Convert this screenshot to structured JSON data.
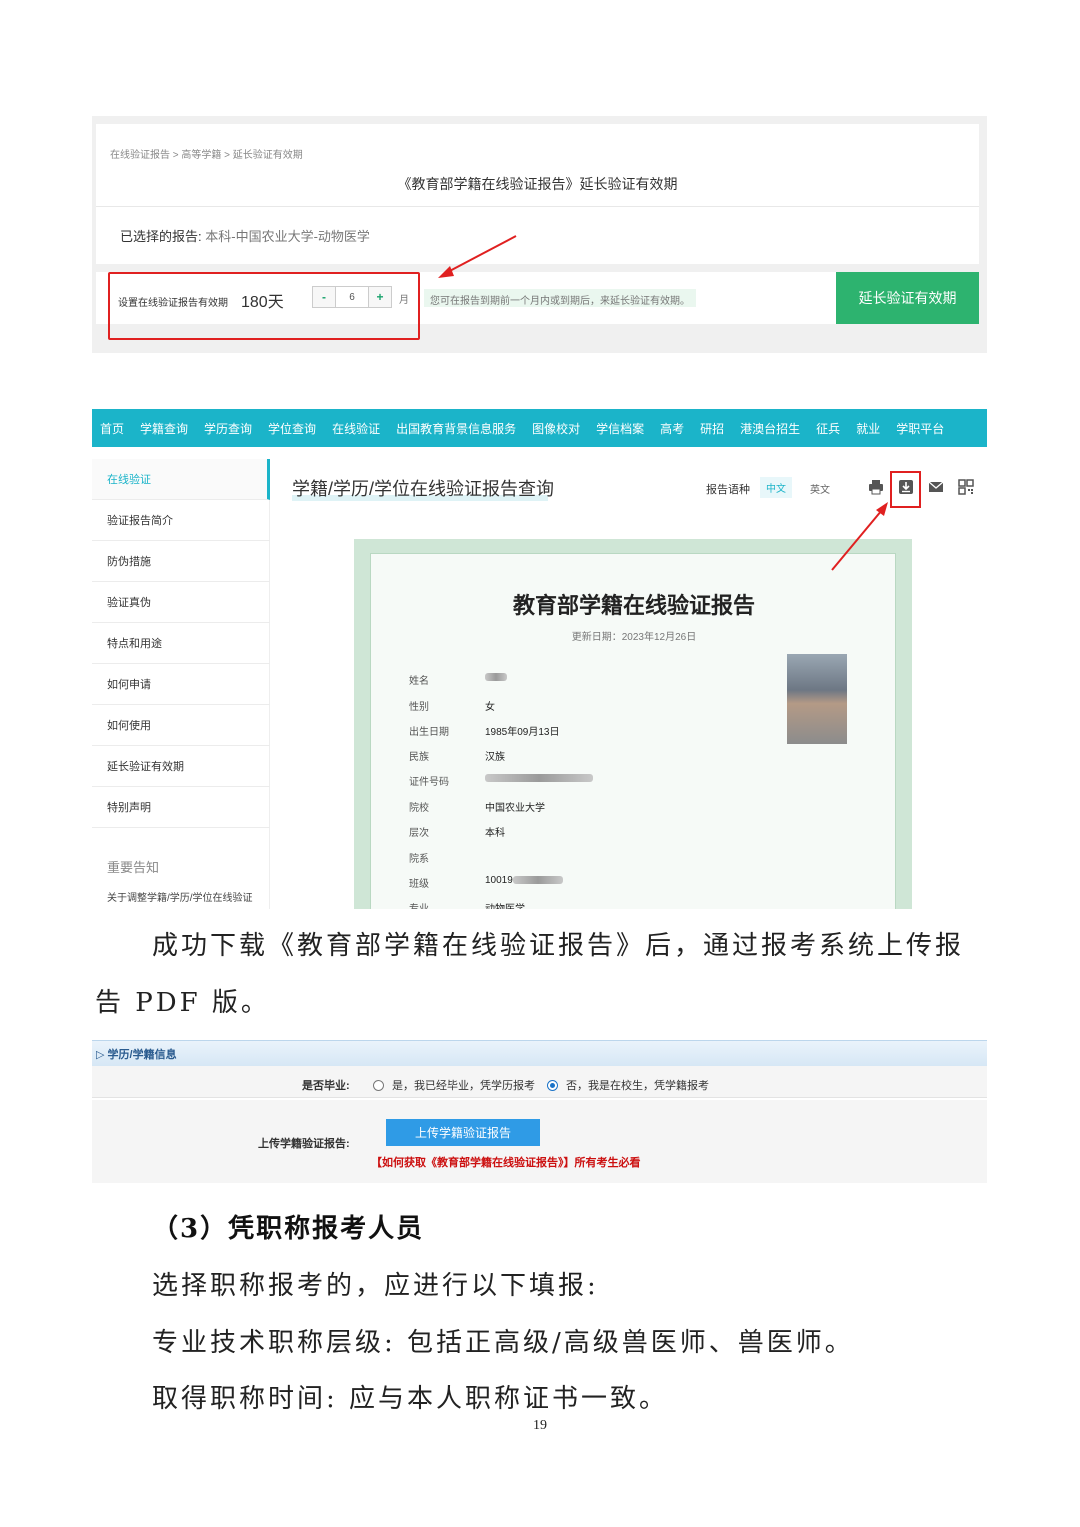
{
  "shot1": {
    "breadcrumb": "在线验证报告 > 高等学籍 > 延长验证有效期",
    "title": "《教育部学籍在线验证报告》延长验证有效期",
    "selected_label": "已选择的报告:",
    "selected_value": "本科-中国农业大学-动物医学",
    "set_label": "设置在线验证报告有效期",
    "days": "180天",
    "minus": "-",
    "stepper_value": "6",
    "plus": "+",
    "unit": "月",
    "hint": "您可在报告到期前一个月内或到期后，来延长验证有效期。",
    "extend_button": "延长验证有效期"
  },
  "shot2": {
    "nav": [
      "首页",
      "学籍查询",
      "学历查询",
      "学位查询",
      "在线验证",
      "出国教育背景信息服务",
      "图像校对",
      "学信档案",
      "高考",
      "研招",
      "港澳台招生",
      "征兵",
      "就业",
      "学职平台"
    ],
    "sidebar": [
      "在线验证",
      "验证报告简介",
      "防伪措施",
      "验证真伪",
      "特点和用途",
      "如何申请",
      "如何使用",
      "延长验证有效期",
      "特别声明"
    ],
    "notice_title": "重要告知",
    "notice_text": "关于调整学籍/学历/学位在线验证",
    "page_title": "学籍/学历/学位在线验证报告查询",
    "lang_label": "报告语种",
    "lang_cn": "中文",
    "lang_en": "英文",
    "icons": [
      "print-icon",
      "download-icon",
      "mail-icon",
      "qrcode-icon"
    ],
    "cert": {
      "title": "教育部学籍在线验证报告",
      "date": "更新日期：2023年12月26日",
      "rows": [
        {
          "k": "姓名",
          "v": ""
        },
        {
          "k": "性别",
          "v": "女"
        },
        {
          "k": "出生日期",
          "v": "1985年09月13日"
        },
        {
          "k": "民族",
          "v": "汉族"
        },
        {
          "k": "证件号码",
          "v": ""
        },
        {
          "k": "院校",
          "v": "中国农业大学"
        },
        {
          "k": "层次",
          "v": "本科"
        },
        {
          "k": "院系",
          "v": ""
        },
        {
          "k": "班级",
          "v": "10019"
        },
        {
          "k": "专业",
          "v": "动物医学"
        }
      ]
    }
  },
  "para1": "成功下载《教育部学籍在线验证报告》后，通过报考系统上传报",
  "para1b": "告 PDF 版。",
  "shot3": {
    "header": "▷ 学历/学籍信息",
    "graduated_label": "是否毕业:",
    "option_yes": "是，我已经毕业，凭学历报考",
    "option_no": "否，我是在校生，凭学籍报考",
    "upload_label": "上传学籍验证报告:",
    "upload_button": "上传学籍验证报告",
    "help_link": "【如何获取《教育部学籍在线验证报告》】所有考生必看"
  },
  "section_title": "（3）凭职称报考人员",
  "para2": "选择职称报考的，应进行以下填报:",
  "para3": "专业技术职称层级: 包括正高级/高级兽医师、兽医师。",
  "para4": "取得职称时间: 应与本人职称证书一致。",
  "page_number": "19",
  "colors": {
    "teal": "#1bb4c9",
    "green": "#2db36f",
    "red": "#e02020",
    "blue": "#2f9be6"
  }
}
